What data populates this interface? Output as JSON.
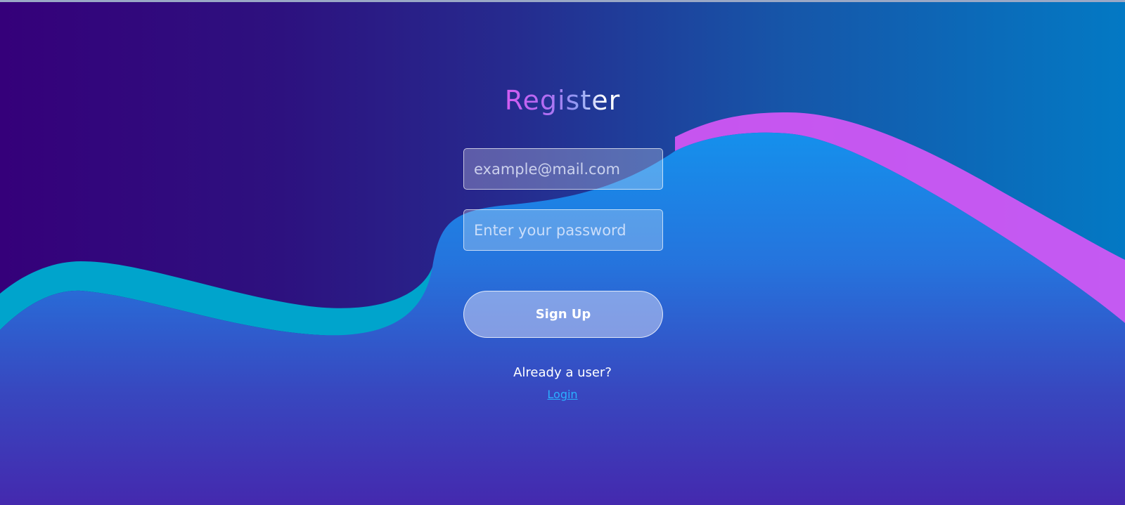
{
  "form": {
    "title": "Register",
    "email_placeholder": "example@mail.com",
    "password_placeholder": "Enter your password",
    "signup_label": "Sign Up",
    "already_user_text": "Already a user?",
    "login_link_label": "Login"
  },
  "colors": {
    "background_left": "#35007a",
    "background_right": "#0379c4",
    "wave_blue": "#2a6fe0",
    "wave_cyan_band": "#00a4cc",
    "wave_magenta_band": "#d957f7",
    "link": "#2bb0ff"
  }
}
